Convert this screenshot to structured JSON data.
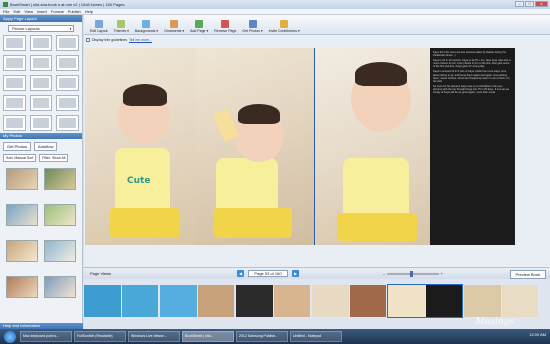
{
  "window": {
    "title": "BookSmart | ulla.ana.book s at one v2 | 10x8 inches | 160 Pages",
    "controls": [
      "–",
      "□",
      "x"
    ]
  },
  "menu": [
    "File",
    "Edit",
    "View",
    "Insert",
    "Format",
    "Publish",
    "Help"
  ],
  "left_panel": {
    "apply_layout_header": "Apply Page Layout",
    "layout_dropdown": "Picture Layouts",
    "my_photos_header": "My Photos",
    "get_photos": "Get Photos",
    "autoflow": "Autoflow",
    "sort_label": "Sort: Manual Sort",
    "filter_label": "Filter: Show All",
    "help_header": "Help and Information"
  },
  "toolbar": [
    {
      "label": "Edit Layout",
      "icon": "edit-layout-icon",
      "color": "#7aa6d8"
    },
    {
      "label": "Themes ▾",
      "icon": "themes-icon",
      "color": "#a7c66d"
    },
    {
      "label": "Backgrounds ▾",
      "icon": "backgrounds-icon",
      "color": "#6fb0e0"
    },
    {
      "label": "Ornaments ▾",
      "icon": "ornaments-icon",
      "color": "#d99a55"
    },
    {
      "label": "Add Page ▾",
      "icon": "add-page-icon",
      "color": "#5aa85a"
    },
    {
      "label": "Remove Page",
      "icon": "remove-page-icon",
      "color": "#d05555"
    },
    {
      "label": "Get Photos ▾",
      "icon": "get-photos-icon",
      "color": "#5d86c5"
    },
    {
      "label": "Invite Contributors ▾",
      "icon": "invite-contributors-icon",
      "color": "#e0b043"
    }
  ],
  "canvas": {
    "guidelines_label": "Display trim guidelines",
    "guidelines_link": "Tell me more...",
    "shirt_text": "Cute",
    "text_page": [
      "Kaya 33 in 16. Here are few pictures taken by Daddy during the Pedestrian shoot. :)",
      "Kaya is 16 in 10 months. Kaya is 1m79 + 1m, days long. Also she is more chance to turn more photos in for on the line. Also gets some of the first pictures, Kaya gave for a long day.",
      "Kaya is at least 10 in 8 pics of Kaya. Aside from cute ways, time about sitting to sit, and being there again and again. Ana ranking there, sweet clothes, shoes and frequently seen in one of them, for her doll.",
      "So once for his pictures Kaya was so comfortable in the new pictures with the her thought Kaya into 75 in 25 days. It is a set we simply of Kaya will be so good again, more than usual."
    ]
  },
  "page_views": {
    "label": "Page Views",
    "page_indicator": "Page 53 of 160",
    "preview_button": "Preview Book"
  },
  "taskbar": {
    "tasks": [
      "Mac keyboard point s...",
      "FullSunNet (Readable)",
      "Windows Live Messe...",
      "BookSmart | ulla...",
      "2012 Samsung Publish...",
      "Untitled - Notepad"
    ],
    "active_index": 3,
    "clock": "12:00 AM",
    "watermark": "Musings"
  }
}
